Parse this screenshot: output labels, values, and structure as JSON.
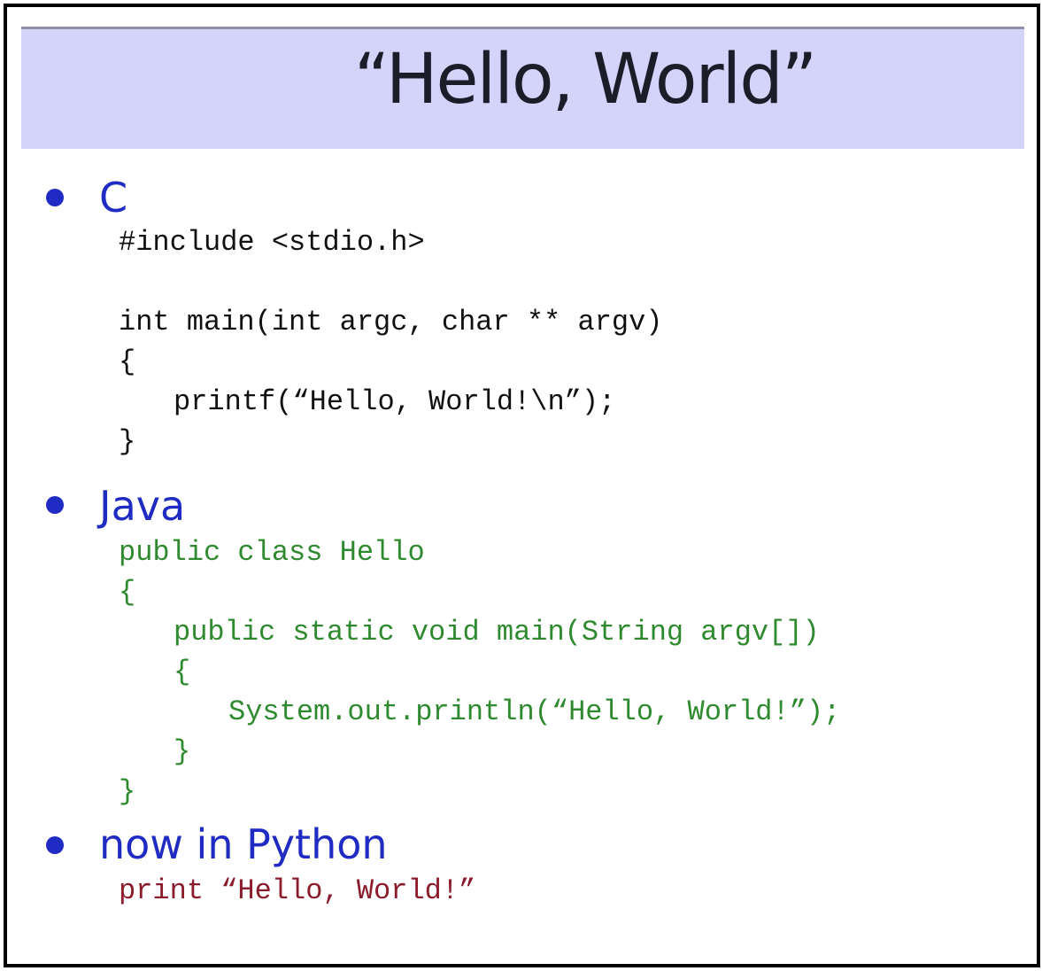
{
  "slide": {
    "title": "“Hello, World”",
    "sections": [
      {
        "heading": "C",
        "lines": [
          "#include <stdio.h>",
          "int main(int argc, char ** argv)",
          "{",
          "printf(“Hello, World!\\n”);",
          "}"
        ]
      },
      {
        "heading": "Java",
        "lines": [
          "public class Hello",
          "{",
          "public static void main(String argv[])",
          "{",
          "System.out.println(“Hello, World!”);",
          "}",
          "}"
        ]
      },
      {
        "heading": "now in Python",
        "lines": [
          "print “Hello, World!”"
        ]
      }
    ]
  },
  "colors": {
    "title_band": "#d4d4fb",
    "heading_blue": "#1f2bc2",
    "c_code": "#111111",
    "java_code": "#2f8a2f",
    "python_code": "#8a1c2c"
  }
}
